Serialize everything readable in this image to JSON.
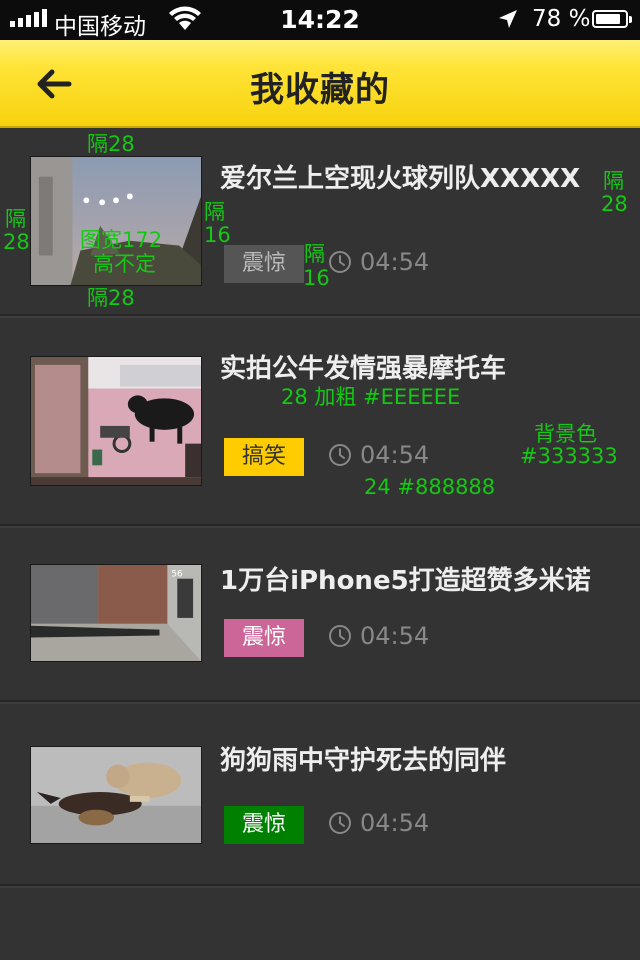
{
  "status_bar": {
    "carrier": "中国移动",
    "time": "14:22",
    "battery": "78 %",
    "battery_level": 0.78,
    "signal_icon": "signal-bars-icon",
    "wifi_icon": "wifi-icon",
    "location_icon": "location-arrow-icon",
    "battery_icon": "battery-icon"
  },
  "header": {
    "title": "我收藏的",
    "back_icon": "back-arrow-icon",
    "background": "#f7d20d"
  },
  "list": {
    "background": "#333333",
    "items": [
      {
        "title": "爱尔兰上空现火球列队XXXXX",
        "tag": "震惊",
        "tag_color": "#555555",
        "duration": "04:54",
        "thumb": "fireball-sky-thumbnail"
      },
      {
        "title": "实拍公牛发情强暴摩托车",
        "tag": "搞笑",
        "tag_color": "#ffcc00",
        "duration": "04:54",
        "thumb": "bull-motorcycle-thumbnail"
      },
      {
        "title": "1万台iPhone5打造超赞多米诺",
        "tag": "震惊",
        "tag_color": "#cc6699",
        "duration": "04:54",
        "thumb": "iphone-domino-thumbnail"
      },
      {
        "title": "狗狗雨中守护死去的同伴",
        "tag": "震惊",
        "tag_color": "#008000",
        "duration": "04:54",
        "thumb": "dog-rain-thumbnail"
      }
    ]
  },
  "annotations": {
    "gap28_top": "隔28",
    "gap28_bottom": "隔28",
    "gap28_left_a": "隔",
    "gap28_left_b": "28",
    "gap16_a": "隔",
    "gap16_b": "16",
    "gap16_c": "隔",
    "gap16_d": "16",
    "gap28_right_a": "隔",
    "gap28_right_b": "28",
    "image_width_a": "图宽172",
    "image_width_b": "高不定",
    "title_spec": "28 加粗 #EEEEEE",
    "bg_label": "背景色",
    "bg_value": "#333333",
    "time_spec": "24 #888888"
  }
}
